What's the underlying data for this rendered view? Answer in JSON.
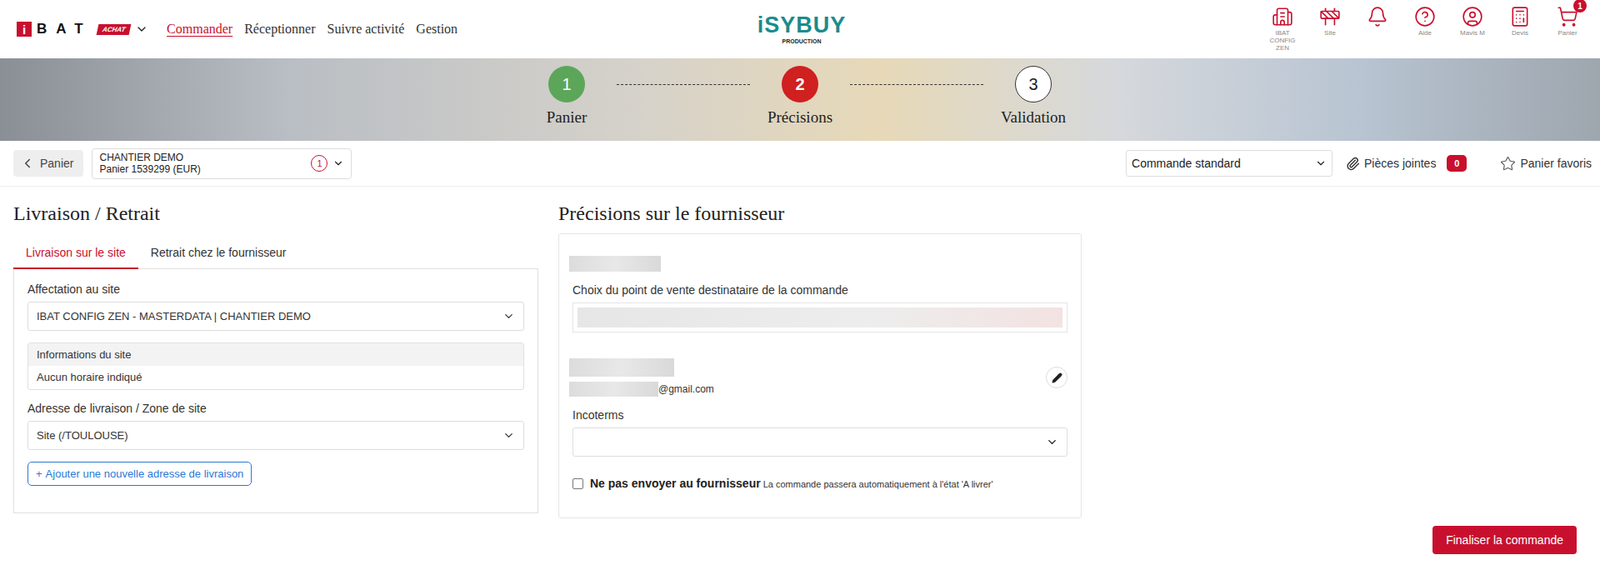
{
  "header": {
    "brand": {
      "mark": "i",
      "letters": "BAT",
      "tag": "ACHAT"
    },
    "nav": [
      {
        "label": "Commander",
        "selected": true
      },
      {
        "label": "Réceptionner",
        "selected": false
      },
      {
        "label": "Suivre activité",
        "selected": false
      },
      {
        "label": "Gestion",
        "selected": false
      }
    ],
    "logo": {
      "title": "iSYBUY",
      "subtitle": "PRODUCTION"
    },
    "actions": [
      {
        "label": "IBAT CONFIG ZEN",
        "badge": ""
      },
      {
        "label": "Site",
        "badge": ""
      },
      {
        "label": "",
        "badge": ""
      },
      {
        "label": "Aide",
        "badge": ""
      },
      {
        "label": "Mavis M",
        "badge": ""
      },
      {
        "label": "Devis",
        "badge": ""
      },
      {
        "label": "Panier",
        "badge": "1"
      }
    ]
  },
  "stepper": [
    {
      "number": "1",
      "label": "Panier",
      "kind": "done"
    },
    {
      "number": "2",
      "label": "Précisions",
      "kind": "current"
    },
    {
      "number": "3",
      "label": "Validation",
      "kind": "todo"
    }
  ],
  "toolbar": {
    "back": "Panier",
    "cart": {
      "site": "CHANTIER DEMO",
      "name": "Panier 1539299 (EUR)",
      "badge": "1"
    },
    "orderType": "Commande standard",
    "attachments": {
      "label": "Pièces jointes",
      "count": "0"
    },
    "favorite": "Panier favoris"
  },
  "delivery": {
    "title": "Livraison / Retrait",
    "tabs": [
      {
        "label": "Livraison sur le site",
        "selected": true
      },
      {
        "label": "Retrait chez le fournisseur",
        "selected": false
      }
    ],
    "siteLabel": "Affectation au site",
    "site": "IBAT CONFIG ZEN - MASTERDATA | CHANTIER DEMO",
    "info": {
      "title": "Informations du site",
      "text": "Aucun horaire indiqué"
    },
    "addressLabel": "Adresse de livraison / Zone de site",
    "address": "Site (/TOULOUSE)",
    "addButton": {
      "plus": "+",
      "label": "Ajouter une nouvelle adresse de livraison"
    }
  },
  "supplier": {
    "title": "Précisions sur le fournisseur",
    "pointLabel": "Choix du point de vente destinataire de la commande",
    "emailDomain": "@gmail.com",
    "incotermsLabel": "Incoterms",
    "incoterms": "",
    "noSend": {
      "checked": false,
      "label": "Ne pas envoyer au fournisseur",
      "hint": "La commande passera automatiquement à l'état 'A livrer'"
    }
  },
  "finalize": "Finaliser la commande"
}
